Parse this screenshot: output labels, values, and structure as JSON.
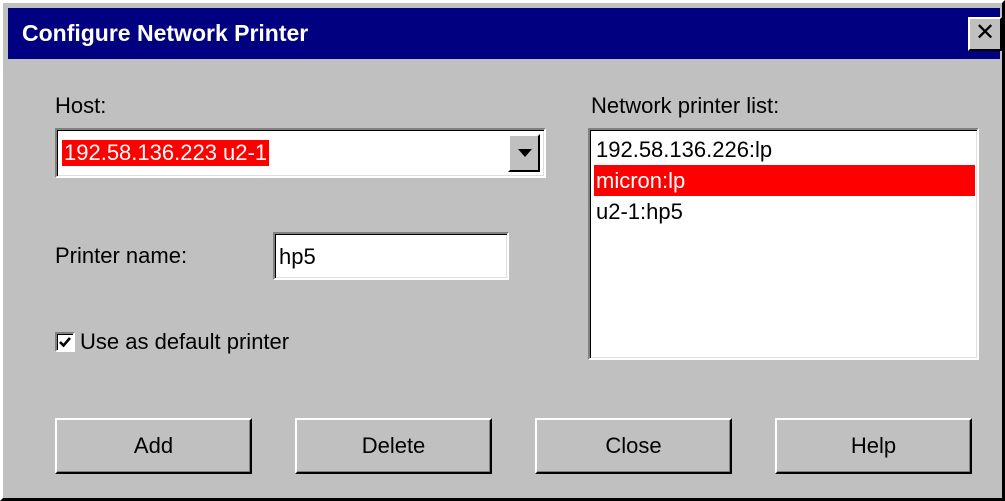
{
  "window": {
    "title": "Configure Network Printer",
    "close_glyph": "✕"
  },
  "host": {
    "label": "Host:",
    "value": "192.58.136.223 u2-1"
  },
  "printer_name": {
    "label": "Printer name:",
    "value": "hp5"
  },
  "default_printer": {
    "label": "Use as default printer",
    "checked": true
  },
  "network_list": {
    "label": "Network printer list:",
    "items": [
      "192.58.136.226:lp",
      "micron:lp",
      "u2-1:hp5"
    ],
    "selected_index": 1
  },
  "buttons": {
    "add": "Add",
    "delete": "Delete",
    "close": "Close",
    "help": "Help"
  },
  "colors": {
    "titlebar": "#000080",
    "selection": "#ff0000",
    "face": "#c0c0c0"
  }
}
